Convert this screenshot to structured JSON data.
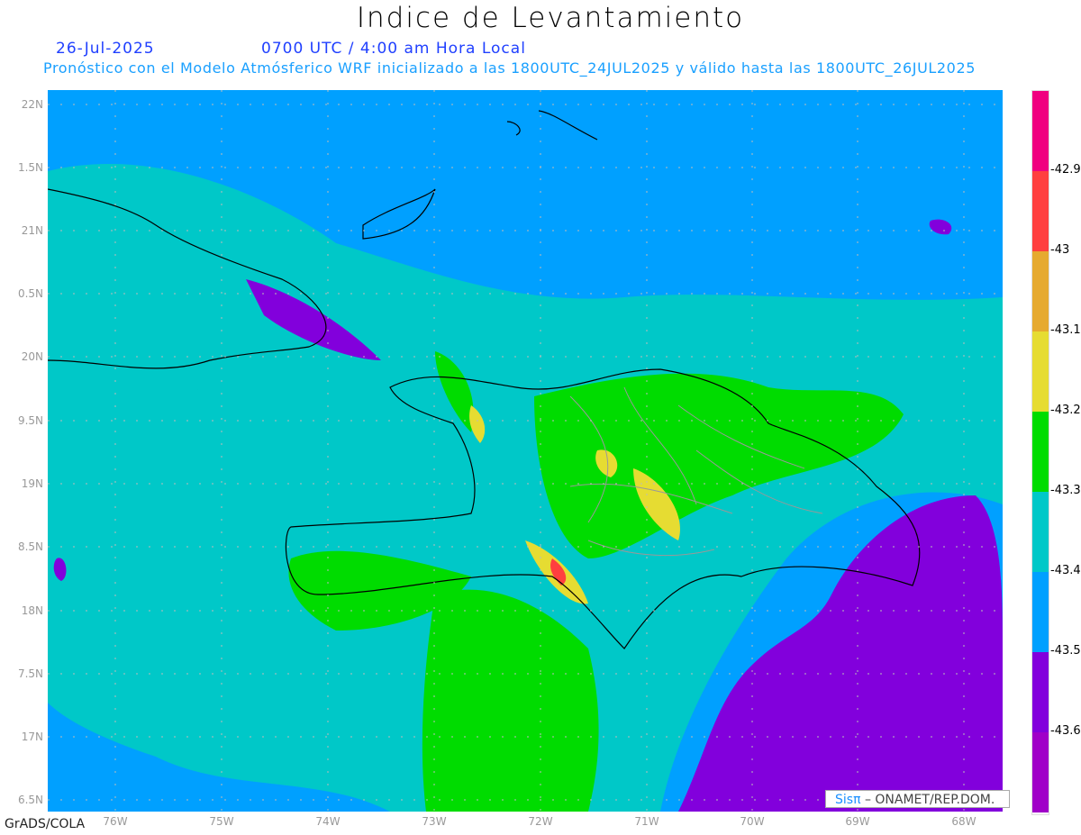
{
  "header": {
    "title": "Indice de Levantamiento",
    "date": "26-Jul-2025",
    "time": "0700 UTC / 4:00 am Hora Local",
    "subtitle": "Pronóstico con el Modelo Atmósferico WRF inicializado a las 1800UTC_24JUL2025 y válido hasta las  1800UTC_26JUL2025"
  },
  "axes": {
    "lat_labels": [
      "22N",
      "1.5N",
      "21N",
      "0.5N",
      "20N",
      "9.5N",
      "19N",
      "8.5N",
      "18N",
      "7.5N",
      "17N",
      "6.5N"
    ],
    "lon_labels": [
      "76W",
      "75W",
      "74W",
      "73W",
      "72W",
      "71W",
      "70W",
      "69W",
      "68W"
    ]
  },
  "legend": {
    "colors": [
      "#f0007f",
      "#ff3f3f",
      "#e6aa30",
      "#e6dc32",
      "#00dc00",
      "#00c8c8",
      "#00a0ff",
      "#8200dc",
      "#a000c8"
    ],
    "labels": [
      "-42.9",
      "-43",
      "-43.1",
      "-43.2",
      "-43.3",
      "-43.4",
      "-43.5",
      "-43.6"
    ]
  },
  "footer": {
    "logo": "Sisπ",
    "text": "– ONAMET/REP.DOM."
  },
  "credit": "GrADS/COLA"
}
